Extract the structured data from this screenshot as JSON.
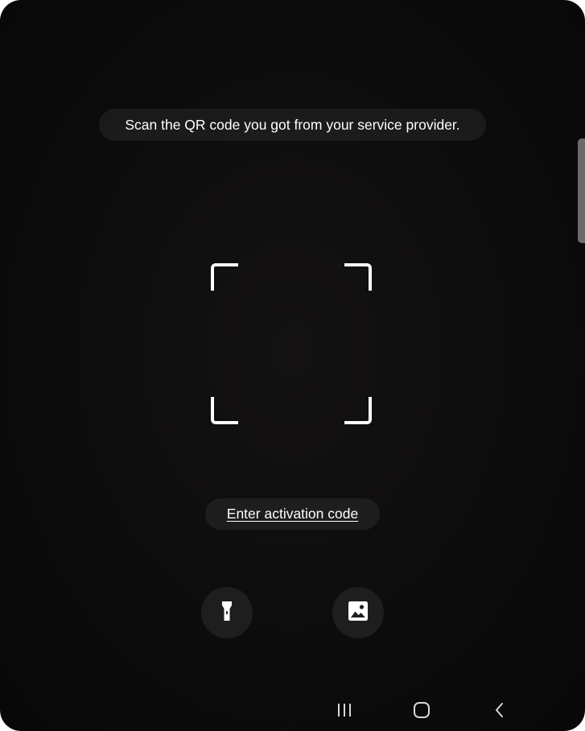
{
  "scanner": {
    "instruction": "Scan the QR code you got from your service provider.",
    "activation_link": "Enter activation code"
  },
  "buttons": {
    "flash_icon": "flashlight-icon",
    "gallery_icon": "gallery-image-icon"
  },
  "navigation": {
    "recents_icon": "recent-apps-icon",
    "home_icon": "home-icon",
    "back_icon": "back-icon"
  },
  "colors": {
    "background": "#0d0c0c",
    "pill_background": "#282828",
    "button_background": "#1f1e1e",
    "foreground": "#ffffff"
  }
}
